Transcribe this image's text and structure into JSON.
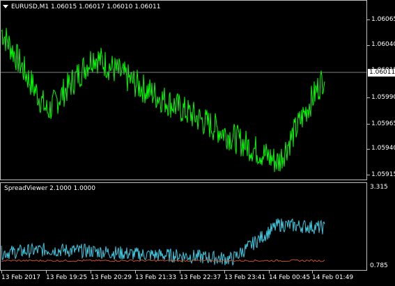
{
  "main_chart": {
    "title": "EURUSD,M1  1.06015 1.06017 1.06010 1.06011",
    "current_price": "1.06011",
    "price_labels": [
      "1.06065",
      "1.06040",
      "1.06015",
      "1.05990",
      "1.05965",
      "1.05940",
      "1.05915"
    ],
    "line_color": "#00ff00"
  },
  "sub_window": {
    "title": "SpreadViewer 2.1000 1.0000",
    "scale_labels": [
      "3.315",
      "0.785"
    ],
    "spread_color": "#40c8e0",
    "low_color": "#c85030"
  },
  "time_axis": {
    "labels": [
      "13 Feb 2017",
      "13 Feb 19:25",
      "13 Feb 20:29",
      "13 Feb 21:33",
      "13 Feb 22:37",
      "13 Feb 23:41",
      "14 Feb 00:45",
      "14 Feb 01:49"
    ]
  },
  "chart_data": [
    {
      "type": "line",
      "title": "EURUSD,M1",
      "x": [
        "13 Feb 2017",
        "13 Feb 19:25",
        "13 Feb 20:29",
        "13 Feb 21:33",
        "13 Feb 22:37",
        "13 Feb 23:41",
        "14 Feb 00:45",
        "14 Feb 01:49"
      ],
      "series": [
        {
          "name": "EURUSD,M1",
          "values": [
            1.06055,
            1.05975,
            1.0603,
            1.06,
            1.05975,
            1.0595,
            1.05925,
            1.06011
          ]
        }
      ],
      "ylim": [
        1.0591,
        1.0608
      ]
    },
    {
      "type": "line",
      "title": "SpreadViewer 2.1000 1.0000",
      "x": [
        "13 Feb 2017",
        "13 Feb 19:25",
        "13 Feb 20:29",
        "13 Feb 21:33",
        "13 Feb 22:37",
        "13 Feb 23:41",
        "14 Feb 00:45",
        "14 Feb 01:49"
      ],
      "series": [
        {
          "values": [
            1.2,
            1.3,
            1.25,
            1.15,
            1.1,
            1.0,
            2.1,
            2.0
          ]
        }
      ],
      "ylim": [
        0.785,
        3.315
      ]
    }
  ]
}
